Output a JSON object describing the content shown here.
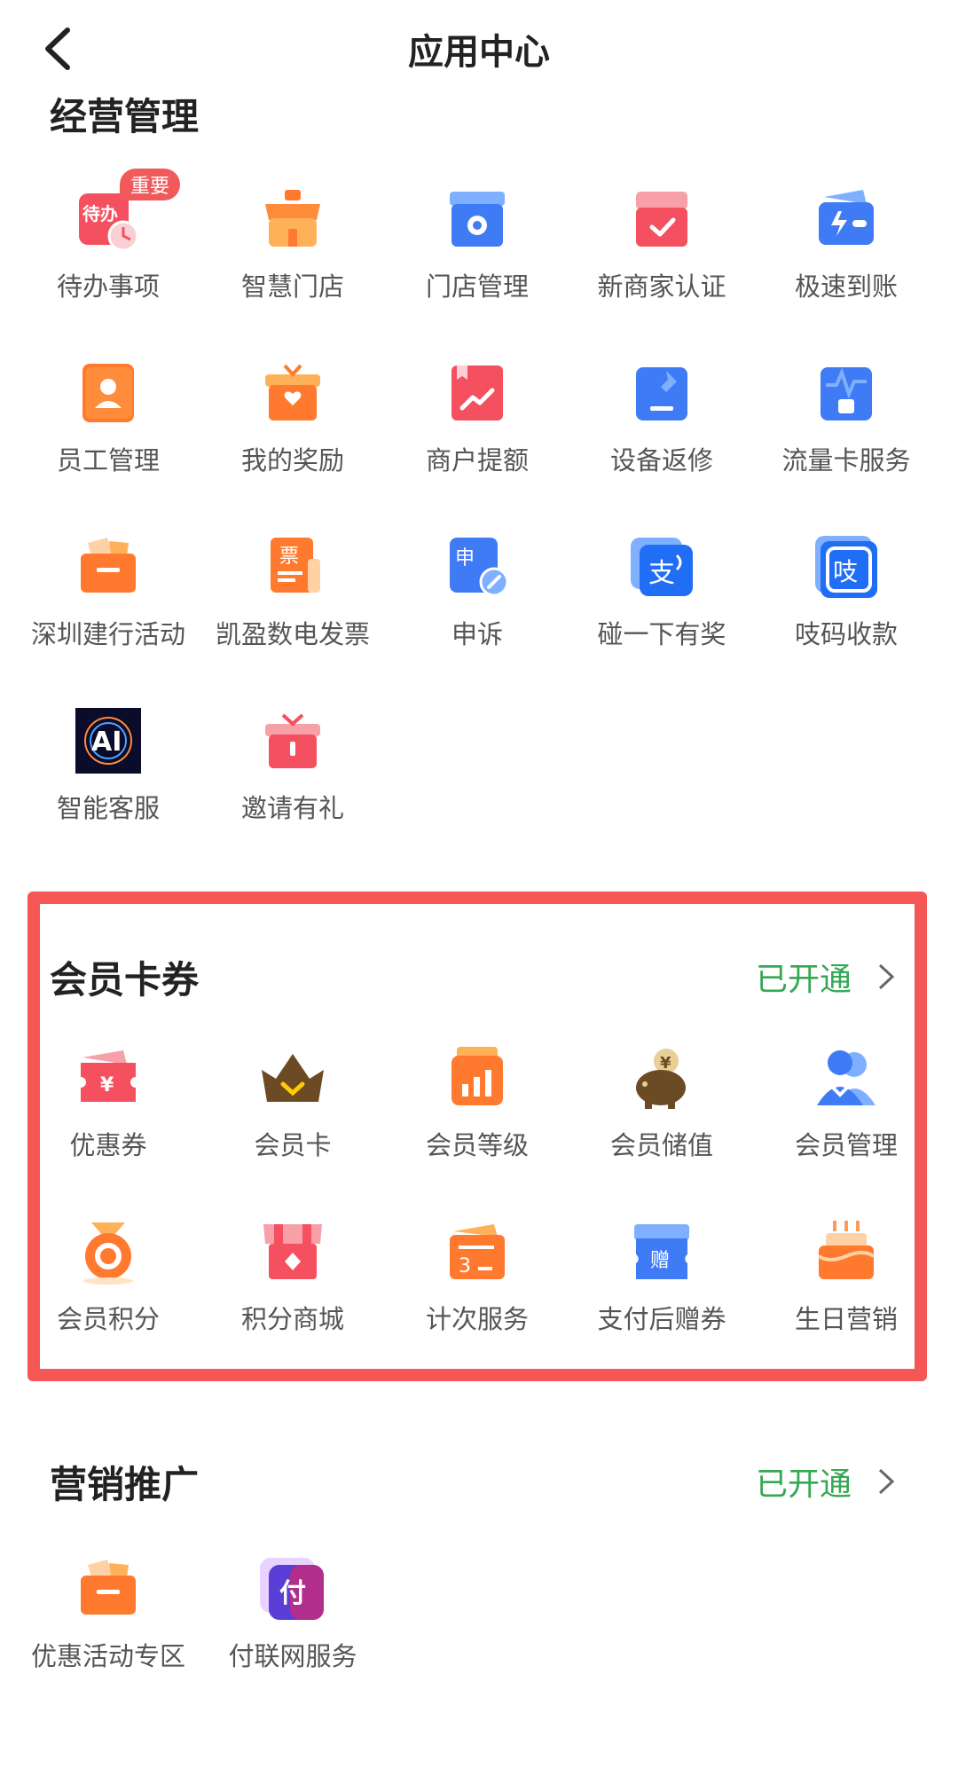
{
  "header": {
    "title": "应用中心"
  },
  "sections": {
    "business": {
      "title": "经营管理",
      "apps": [
        {
          "label": "待办事项",
          "badge": "重要",
          "icon_text": "待办"
        },
        {
          "label": "智慧门店"
        },
        {
          "label": "门店管理"
        },
        {
          "label": "新商家认证"
        },
        {
          "label": "极速到账"
        },
        {
          "label": "员工管理"
        },
        {
          "label": "我的奖励"
        },
        {
          "label": "商户提额"
        },
        {
          "label": "设备返修"
        },
        {
          "label": "流量卡服务"
        },
        {
          "label": "深圳建行活动"
        },
        {
          "label": "凯盈数电发票",
          "icon_text": "票"
        },
        {
          "label": "申诉",
          "icon_text": "申"
        },
        {
          "label": "碰一下有奖",
          "icon_text": "支"
        },
        {
          "label": "吱码收款",
          "icon_text": "吱"
        },
        {
          "label": "智能客服",
          "icon_text": "AI"
        },
        {
          "label": "邀请有礼"
        }
      ]
    },
    "member": {
      "title": "会员卡券",
      "status": "已开通",
      "apps": [
        {
          "label": "优惠券",
          "icon_text": "¥"
        },
        {
          "label": "会员卡"
        },
        {
          "label": "会员等级"
        },
        {
          "label": "会员储值",
          "icon_text": "¥"
        },
        {
          "label": "会员管理"
        },
        {
          "label": "会员积分"
        },
        {
          "label": "积分商城"
        },
        {
          "label": "计次服务",
          "icon_text": "3"
        },
        {
          "label": "支付后赠券",
          "icon_text": "赠"
        },
        {
          "label": "生日营销"
        }
      ]
    },
    "marketing": {
      "title": "营销推广",
      "status": "已开通",
      "apps": [
        {
          "label": "优惠活动专区"
        },
        {
          "label": "付联网服务",
          "icon_text": "付"
        }
      ]
    }
  },
  "colors": {
    "accent_green": "#34a853",
    "highlight_red": "#f55656",
    "badge_red": "#f05a5a"
  }
}
